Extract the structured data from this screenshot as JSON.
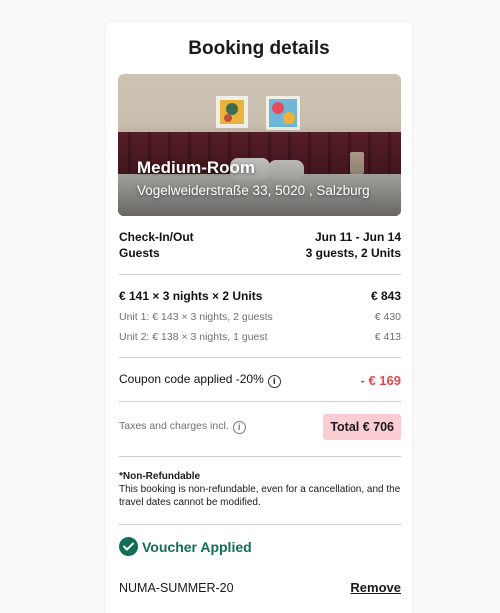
{
  "page": {
    "title": "Booking details"
  },
  "hero": {
    "room_name": "Medium-Room",
    "address": "Vogelweiderstraße 33, 5020 , Salzburg"
  },
  "stay": {
    "checkin_label": "Check-In/Out",
    "checkin_value": "Jun 11 - Jun 14",
    "guests_label": "Guests",
    "guests_value": "3 guests, 2 Units"
  },
  "pricing": {
    "summary_label": "€ 141 × 3 nights × 2 Units",
    "summary_value": "€ 843",
    "units": [
      {
        "label": "Unit 1: € 143 × 3 nights, 2 guests",
        "value": "€ 430"
      },
      {
        "label": "Unit 2: € 138 × 3 nights, 1 guest",
        "value": "€ 413"
      }
    ]
  },
  "coupon": {
    "label": "Coupon code applied -20%",
    "value": "- € 169"
  },
  "totals": {
    "taxes_label": "Taxes and charges incl.",
    "total_label": "Total € 706"
  },
  "policy": {
    "title": "*Non-Refundable",
    "text": "This booking is non-refundable, even for a cancellation, and the travel dates cannot be modified."
  },
  "voucher": {
    "status": "Voucher Applied",
    "code": "NUMA-SUMMER-20",
    "remove_label": "Remove"
  },
  "colors": {
    "accent_green": "#0f6e55",
    "discount_red": "#e5484d",
    "total_badge_bg": "#f9cdd2"
  }
}
